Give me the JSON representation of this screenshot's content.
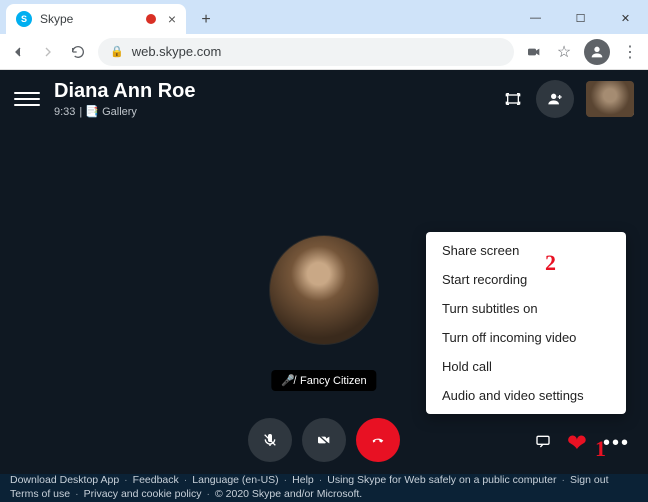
{
  "browser": {
    "tab_title": "Skype",
    "url": "web.skype.com",
    "window_buttons": {
      "min": "—",
      "max": "☐",
      "close": "✕"
    }
  },
  "header": {
    "contact_name": "Diana Ann Roe",
    "timer": "9:33",
    "view_label": "| 📑 Gallery"
  },
  "self_name_tag": "Fancy Citizen",
  "menu": {
    "items": [
      "Share screen",
      "Start recording",
      "Turn subtitles on",
      "Turn off incoming video",
      "Hold call",
      "Audio and video settings"
    ]
  },
  "annotations": {
    "one": "1",
    "two": "2"
  },
  "footer": {
    "row1": [
      "Download Desktop App",
      "Feedback",
      "Language (en-US)",
      "Help",
      "Using Skype for Web safely on a public computer",
      "Sign out"
    ],
    "row2": [
      "Terms of use",
      "Privacy and cookie policy",
      "© 2020 Skype and/or Microsoft."
    ]
  }
}
